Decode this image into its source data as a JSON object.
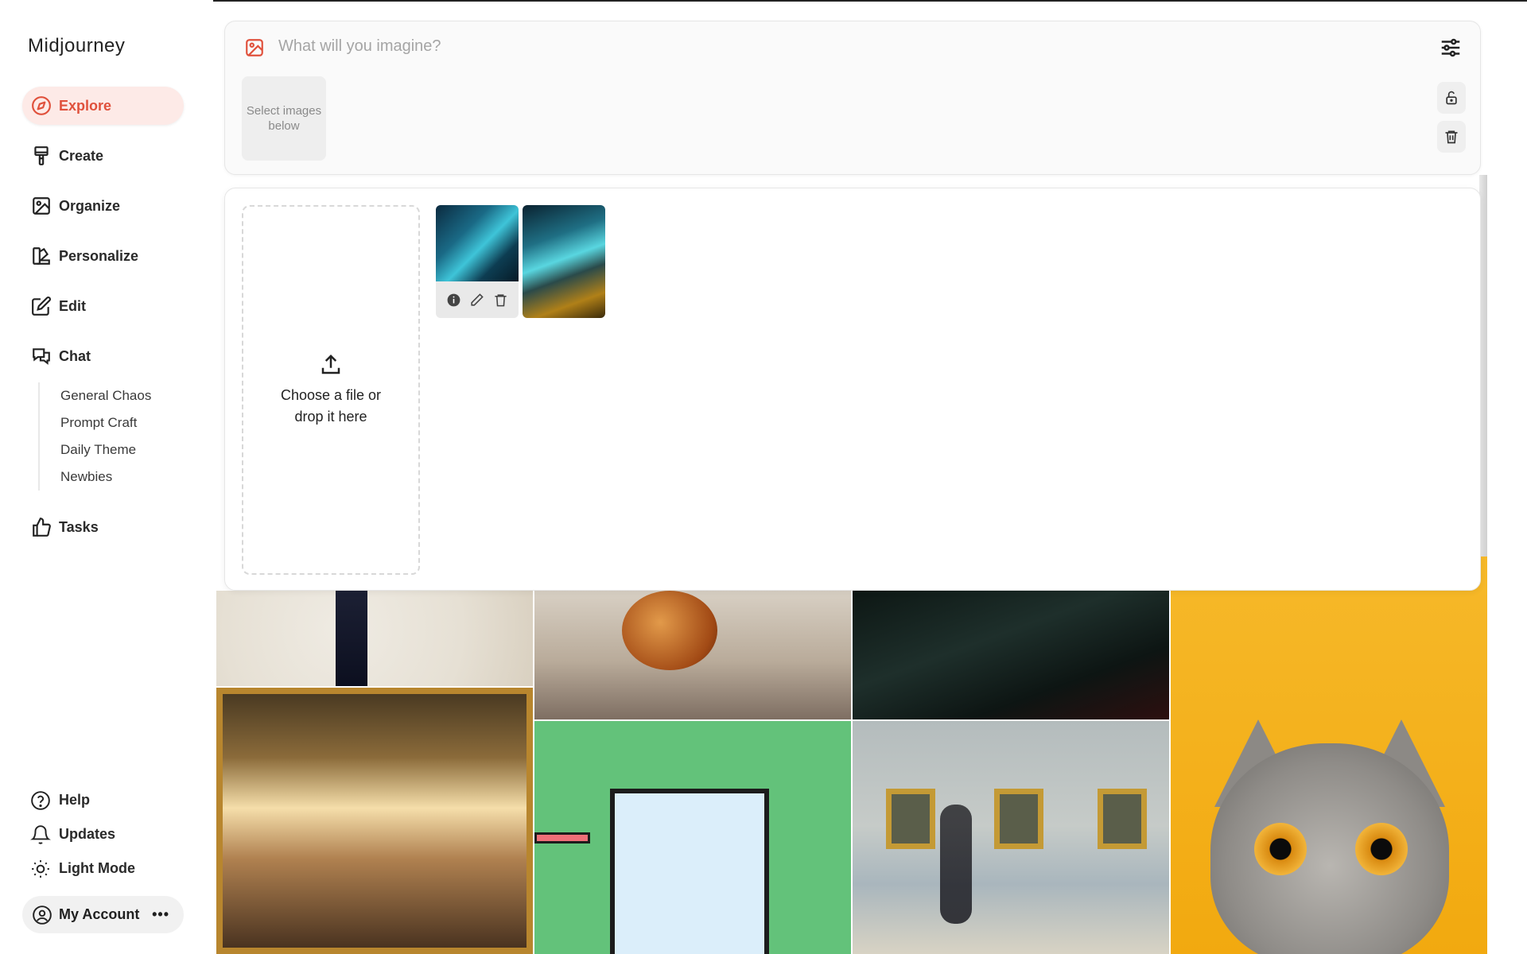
{
  "app": {
    "name": "Midjourney"
  },
  "sidebar": {
    "items": [
      {
        "label": "Explore",
        "icon": "compass-icon",
        "active": true
      },
      {
        "label": "Create",
        "icon": "paintbrush-icon"
      },
      {
        "label": "Organize",
        "icon": "image-frame-icon"
      },
      {
        "label": "Personalize",
        "icon": "palette-swatch-icon"
      },
      {
        "label": "Edit",
        "icon": "edit-pencil-icon"
      },
      {
        "label": "Chat",
        "icon": "chat-bubbles-icon"
      }
    ],
    "chat_rooms": [
      "General Chaos",
      "Prompt Craft",
      "Daily Theme",
      "Newbies"
    ],
    "tasks": {
      "label": "Tasks",
      "icon": "thumbs-up-icon"
    },
    "bottom": [
      {
        "label": "Help",
        "icon": "help-circle-icon"
      },
      {
        "label": "Updates",
        "icon": "bell-icon"
      },
      {
        "label": "Light Mode",
        "icon": "sun-icon"
      }
    ],
    "account": {
      "label": "My Account",
      "more": "•••"
    }
  },
  "prompt": {
    "placeholder": "What will you imagine?",
    "select_hint": "Select images below"
  },
  "upload": {
    "drop_text_line1": "Choose a file or",
    "drop_text_line2": "drop it here"
  },
  "colors": {
    "accent": "#e0513c",
    "accent_bg": "#fdeae7"
  }
}
